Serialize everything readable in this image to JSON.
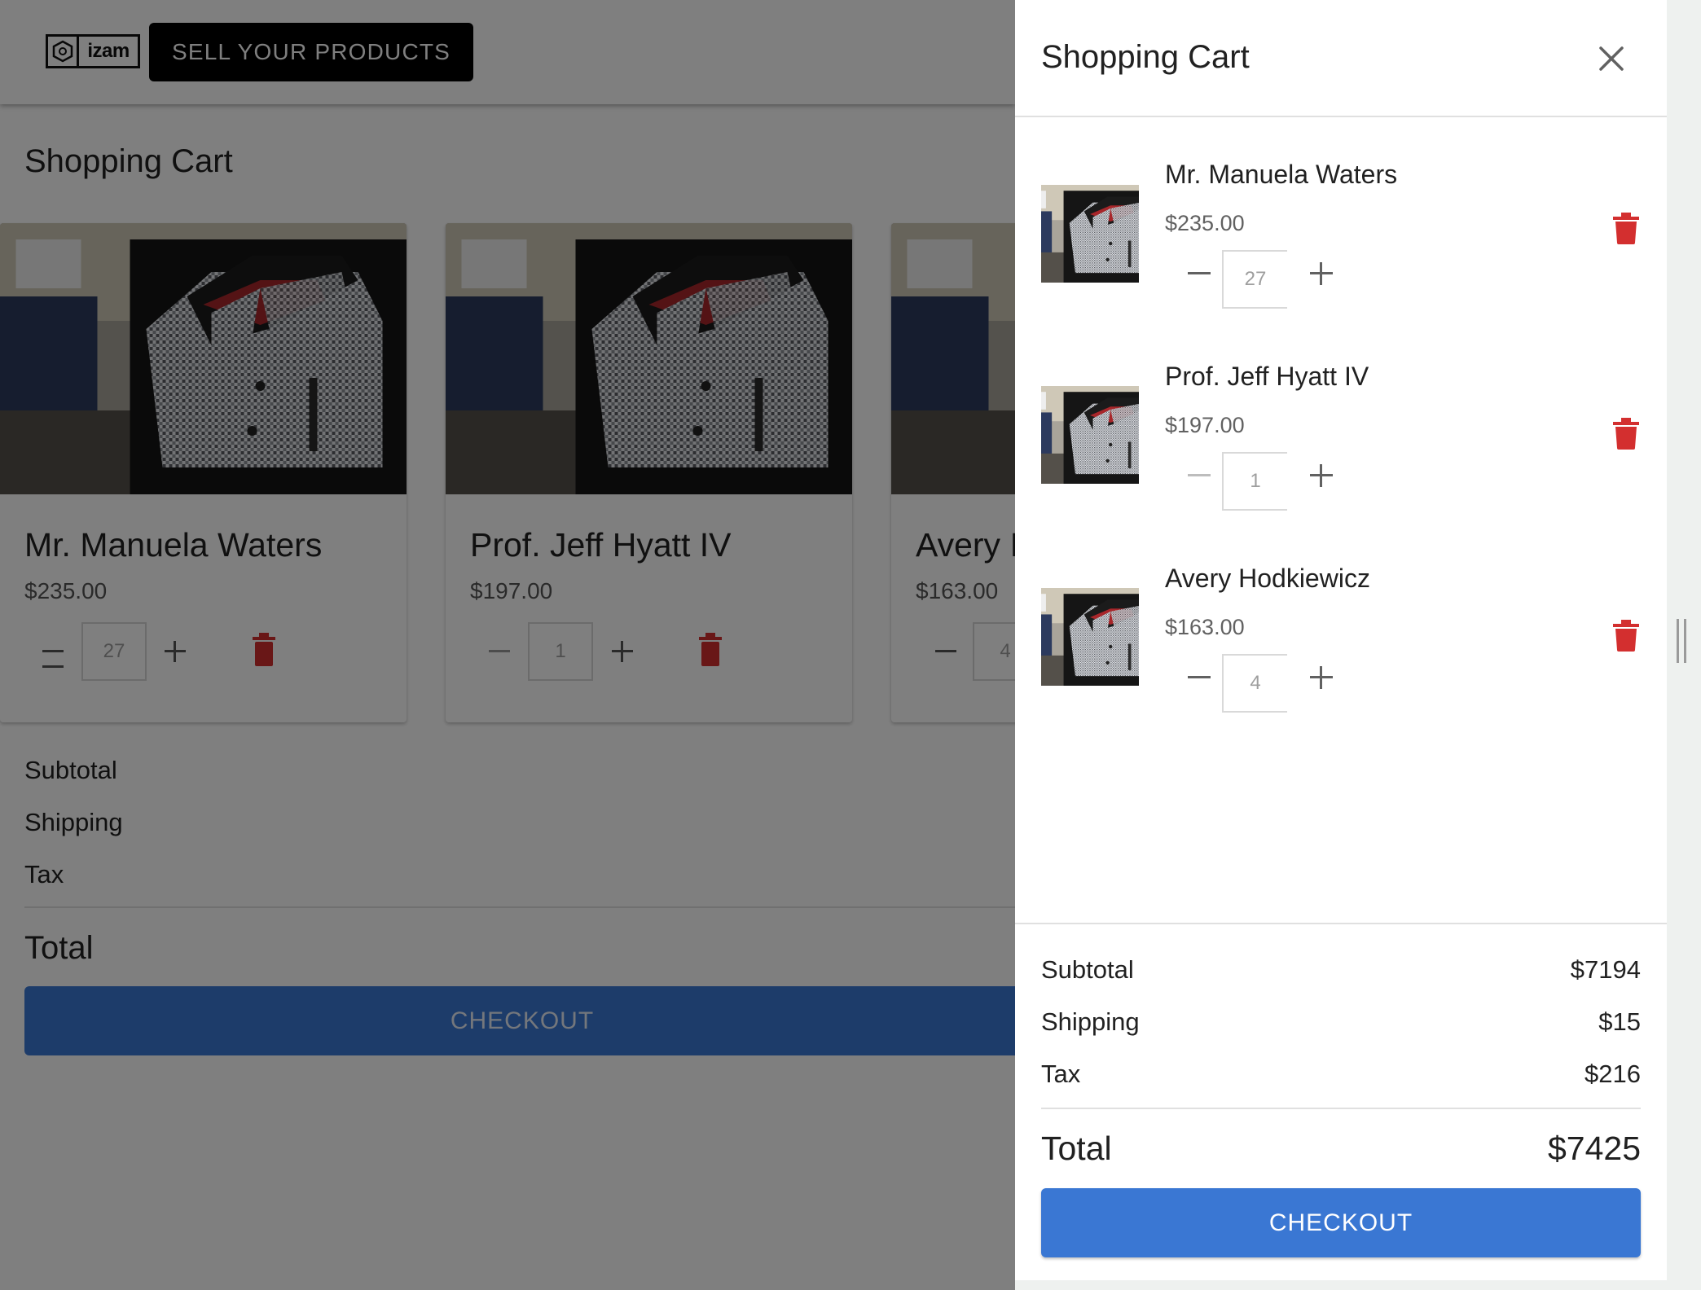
{
  "app": {
    "logo_text": "izam",
    "sell_button_label": "SELL YOUR PRODUCTS"
  },
  "page": {
    "title": "Shopping Cart",
    "cards": [
      {
        "name": "Mr. Manuela Waters",
        "price": "$235.00",
        "quantity": "27"
      },
      {
        "name": "Prof. Jeff Hyatt IV",
        "price": "$197.00",
        "quantity": "1"
      },
      {
        "name": "Avery I",
        "price": "$163.00",
        "quantity": "4"
      }
    ],
    "summary": {
      "subtotal_label": "Subtotal",
      "shipping_label": "Shipping",
      "tax_label": "Tax",
      "total_label": "Total"
    },
    "checkout_label": "CHECKOUT"
  },
  "drawer": {
    "title": "Shopping Cart",
    "items": [
      {
        "name": "Mr. Manuela Waters",
        "price": "$235.00",
        "quantity": "27"
      },
      {
        "name": "Prof. Jeff Hyatt IV",
        "price": "$197.00",
        "quantity": "1"
      },
      {
        "name": "Avery Hodkiewicz",
        "price": "$163.00",
        "quantity": "4"
      }
    ],
    "summary": {
      "subtotal_label": "Subtotal",
      "subtotal_value": "$7194",
      "shipping_label": "Shipping",
      "shipping_value": "$15",
      "tax_label": "Tax",
      "tax_value": "$216",
      "total_label": "Total",
      "total_value": "$7425"
    },
    "checkout_label": "CHECKOUT"
  },
  "icons": {
    "close": "close-icon",
    "minus": "minus-icon",
    "plus": "plus-icon",
    "delete": "trash-icon"
  },
  "colors": {
    "primary": "#3a77d3",
    "danger": "#d32f2f",
    "scrim": "rgba(0,0,0,0.5)"
  }
}
